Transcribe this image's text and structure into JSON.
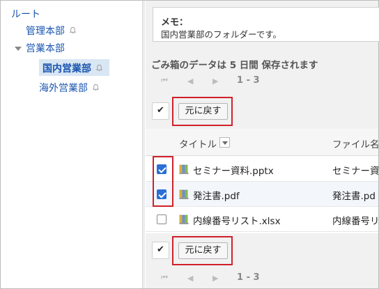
{
  "sidebar": {
    "root_label": "ルート",
    "items": [
      {
        "label": "管理本部"
      },
      {
        "label": "営業本部"
      },
      {
        "label": "国内営業部"
      },
      {
        "label": "海外営業部"
      }
    ]
  },
  "memo": {
    "title": "メモ：",
    "text": "国内営業部のフォルダーです。"
  },
  "trash_note": "ごみ箱のデータは 5 日間 保存されます",
  "pager": {
    "first": "⏮",
    "prev": "◀",
    "next": "▶",
    "range": "1 - 3"
  },
  "toolbar": {
    "check_all": "✔",
    "restore_label": "元に戻す"
  },
  "table": {
    "columns": [
      "タイトル",
      "ファイル名"
    ],
    "rows": [
      {
        "title": "セミナー資料.pptx",
        "file": "セミナー資",
        "checked": true
      },
      {
        "title": "発注書.pdf",
        "file": "発注書.pd",
        "checked": true
      },
      {
        "title": "内線番号リスト.xlsx",
        "file": "内線番号リ",
        "checked": false
      }
    ]
  },
  "colors": {
    "link": "#1a55b0",
    "highlight": "#d0202a",
    "checkbox_on": "#2b6fd6",
    "selected_bg": "#d9e6f3"
  }
}
